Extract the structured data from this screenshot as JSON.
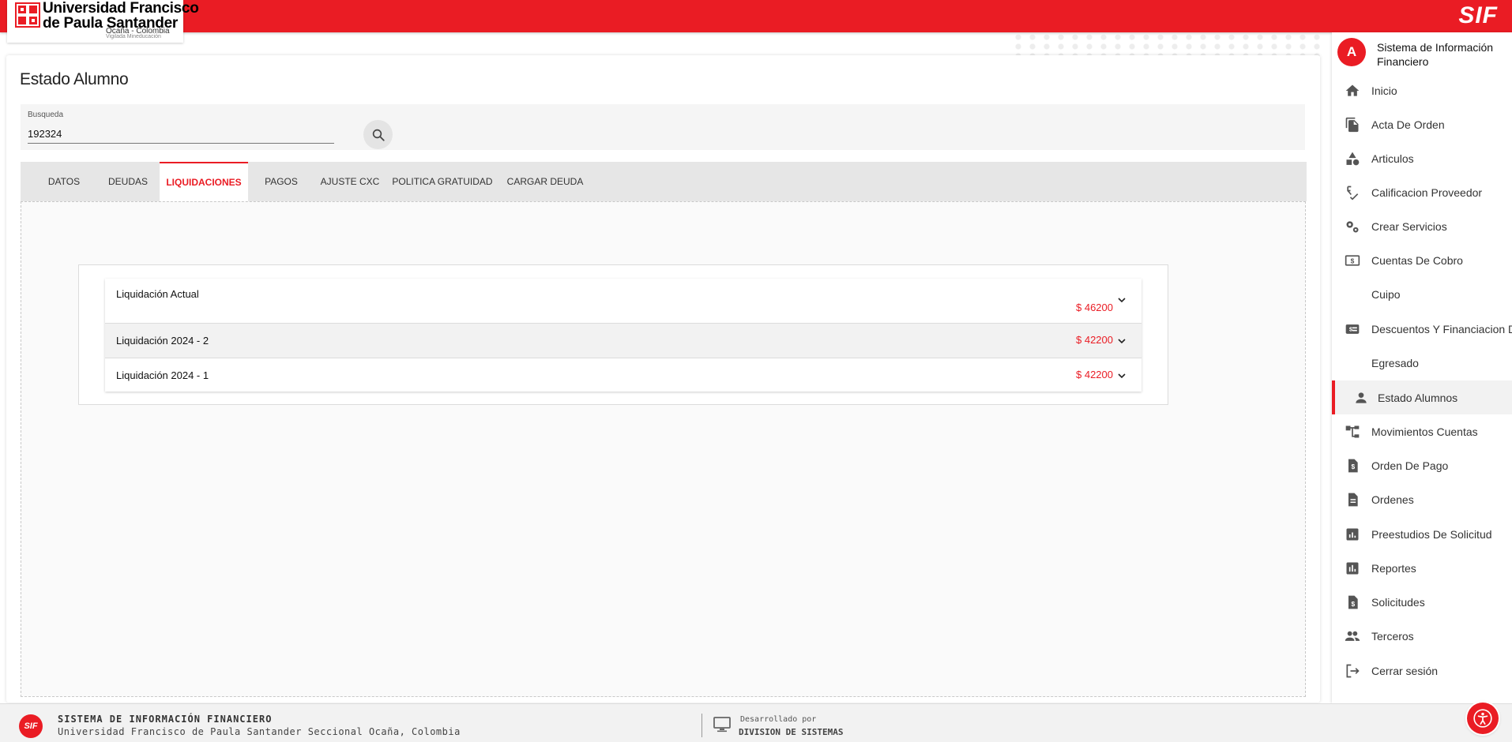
{
  "header": {
    "university_name_line1": "Universidad Francisco",
    "university_name_line2": "de Paula Santander",
    "university_location": "Ocaña - Colombia",
    "university_vigilance": "Vigilada Mineducación",
    "brand": "SIF"
  },
  "page": {
    "title": "Estado Alumno"
  },
  "search": {
    "label": "Busqueda",
    "value": "192324",
    "icon": "search-icon"
  },
  "tabs": [
    {
      "label": "DATOS",
      "active": false
    },
    {
      "label": "DEUDAS",
      "active": false
    },
    {
      "label": "LIQUIDACIONES",
      "active": true
    },
    {
      "label": "PAGOS",
      "active": false
    },
    {
      "label": "AJUSTE CXC",
      "active": false
    },
    {
      "label": "POLITICA GRATUIDAD",
      "active": false
    },
    {
      "label": "CARGAR DEUDA",
      "active": false
    }
  ],
  "liquidaciones": [
    {
      "label": "Liquidación Actual",
      "amount": "$ 46200"
    },
    {
      "label": "Liquidación 2024 - 2",
      "amount": "$ 42200"
    },
    {
      "label": "Liquidación 2024 - 1",
      "amount": "$ 42200"
    }
  ],
  "sidebar": {
    "avatar_letter": "A",
    "title": "Sistema de Información Financiero",
    "items": [
      {
        "label": "Inicio",
        "icon": "home-icon"
      },
      {
        "label": "Acta De Orden",
        "icon": "document-copy-icon"
      },
      {
        "label": "Articulos",
        "icon": "shapes-icon"
      },
      {
        "label": "Calificacion Proveedor",
        "icon": "spellcheck-icon"
      },
      {
        "label": "Crear Servicios",
        "icon": "gears-icon"
      },
      {
        "label": "Cuentas De Cobro",
        "icon": "money-icon"
      },
      {
        "label": "Cuipo",
        "icon": ""
      },
      {
        "label": "Descuentos Y Financiacion De",
        "icon": "price-tag-icon"
      },
      {
        "label": "Egresado",
        "icon": ""
      },
      {
        "label": "Estado Alumnos",
        "icon": "person-icon",
        "active": true
      },
      {
        "label": "Movimientos Cuentas",
        "icon": "account-tree-icon"
      },
      {
        "label": "Orden De Pago",
        "icon": "request-quote-icon"
      },
      {
        "label": "Ordenes",
        "icon": "description-icon"
      },
      {
        "label": "Preestudios De Solicitud",
        "icon": "analytics-icon"
      },
      {
        "label": "Reportes",
        "icon": "bar-chart-icon"
      },
      {
        "label": "Solicitudes",
        "icon": "request-page-icon"
      },
      {
        "label": "Terceros",
        "icon": "people-icon"
      },
      {
        "label": "Cerrar sesión",
        "icon": "logout-icon"
      }
    ]
  },
  "footer": {
    "logo_text": "SIF",
    "title": "SISTEMA DE INFORMACIÓN FINANCIERO",
    "subtitle": "Universidad Francisco de Paula Santander Seccional Ocaña, Colombia",
    "developed_by": "Desarrollado por",
    "division": "DIVISION DE SISTEMAS"
  },
  "colors": {
    "accent": "#ea1c24",
    "tab_bar": "#e6e6e6",
    "background": "#fafafa"
  }
}
